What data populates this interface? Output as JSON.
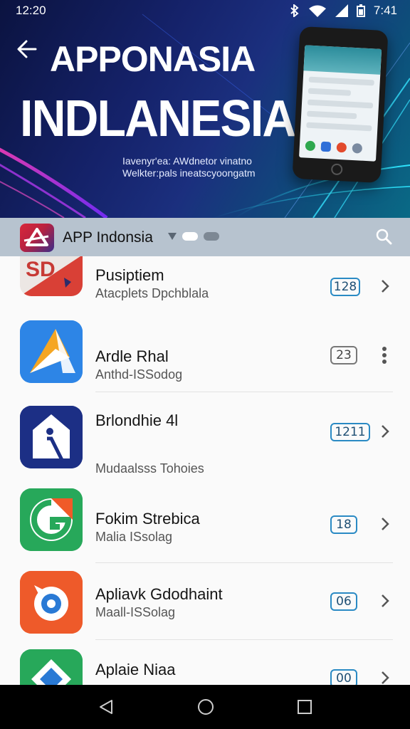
{
  "status_bar": {
    "time_left": "12:20",
    "time_right": "7:41"
  },
  "hero": {
    "title_line1": "APPONASIA",
    "title_line2": "INDLANESIA",
    "subtitle_line1": "Iavenyr'ea: AWdnetor vinatno",
    "subtitle_line2": "Welkter:pals ineatscyoongatm"
  },
  "app_bar": {
    "title": "APP Indonsia"
  },
  "apps": [
    {
      "name": "Pusiptiem",
      "sub": "Atacplets Dpchblala",
      "badge": "128",
      "action": "chevron"
    },
    {
      "name": "Ardle Rhal",
      "sub": "Anthd-ISSodog",
      "badge": "23",
      "action": "more"
    },
    {
      "name": "Brlondhie 4l",
      "sub": "Mudaalsss Tohoies",
      "badge": "1211",
      "action": "chevron"
    },
    {
      "name": "Fokim Strebica",
      "sub": "Malia ISsolag",
      "badge": "18",
      "action": "chevron"
    },
    {
      "name": "Apliavk Gdodhaint",
      "sub": "Maall-ISSolag",
      "badge": "06",
      "action": "chevron"
    },
    {
      "name": "Aplaie Niaa",
      "sub": "",
      "badge": "00",
      "action": "chevron"
    }
  ],
  "colors": {
    "accent": "#2a8ac4",
    "app_bar": "#b7c3cf",
    "hero_dark": "#0b1340"
  }
}
